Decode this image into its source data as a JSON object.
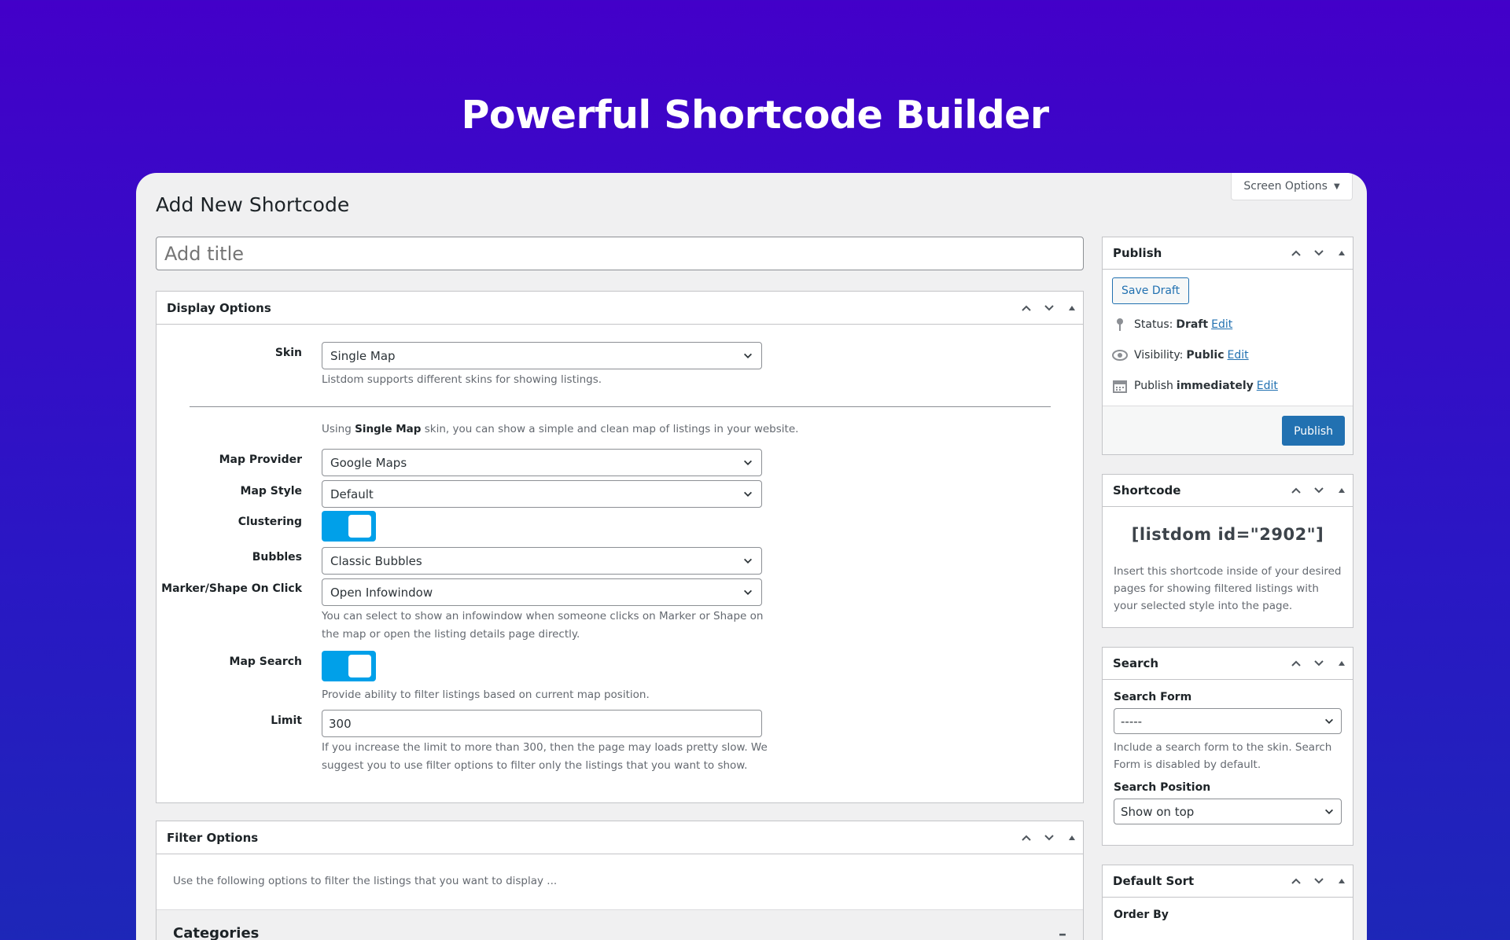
{
  "hero": {
    "title": "Powerful Shortcode Builder"
  },
  "screen_options": {
    "label": "Screen Options"
  },
  "page": {
    "title": "Add New Shortcode"
  },
  "title_input": {
    "placeholder": "Add title"
  },
  "display_options": {
    "title": "Display Options",
    "skin": {
      "label": "Skin",
      "value": "Single Map",
      "desc": "Listdom supports different skins for showing listings."
    },
    "skin_info": {
      "prefix": "Using ",
      "skin_name": "Single Map",
      "suffix": " skin, you can show a simple and clean map of listings in your website."
    },
    "map_provider": {
      "label": "Map Provider",
      "value": "Google Maps"
    },
    "map_style": {
      "label": "Map Style",
      "value": "Default"
    },
    "clustering": {
      "label": "Clustering",
      "enabled": true
    },
    "bubbles": {
      "label": "Bubbles",
      "value": "Classic Bubbles"
    },
    "marker_click": {
      "label": "Marker/Shape On Click",
      "value": "Open Infowindow",
      "desc": "You can select to show an infowindow when someone clicks on Marker or Shape on the map or open the listing details page directly."
    },
    "map_search": {
      "label": "Map Search",
      "enabled": true,
      "desc": "Provide ability to filter listings based on current map position."
    },
    "limit": {
      "label": "Limit",
      "value": "300",
      "desc": "If you increase the limit to more than 300, then the page may loads pretty slow. We suggest you to use filter options to filter only the listings that you want to show."
    }
  },
  "filter_options": {
    "title": "Filter Options",
    "desc": "Use the following options to filter the listings that you want to display ...",
    "categories_label": "Categories",
    "collapse_glyph": "–"
  },
  "publish": {
    "title": "Publish",
    "save_draft": "Save Draft",
    "status_label": "Status:",
    "status_value": "Draft",
    "visibility_label": "Visibility:",
    "visibility_value": "Public",
    "publish_label": "Publish",
    "publish_value": "immediately",
    "edit_link": "Edit",
    "publish_button": "Publish"
  },
  "shortcode": {
    "title": "Shortcode",
    "code": "[listdom id=\"2902\"]",
    "desc": "Insert this shortcode inside of your desired pages for showing filtered listings with your selected style into the page."
  },
  "search": {
    "title": "Search",
    "form_label": "Search Form",
    "form_value": "-----",
    "form_desc": "Include a search form to the skin. Search Form is disabled by default.",
    "position_label": "Search Position",
    "position_value": "Show on top"
  },
  "default_sort": {
    "title": "Default Sort",
    "order_by_label": "Order By"
  },
  "colors": {
    "accent": "#2271b1",
    "toggle": "#00a0e9",
    "background_top": "#4300c9",
    "background_bottom": "#1d27b8"
  },
  "icons": {
    "status": "pin-icon",
    "visibility": "eye-icon",
    "schedule": "calendar-icon",
    "move_up": "chevron-up-icon",
    "move_down": "chevron-down-icon",
    "toggle_panel": "triangle-up-icon"
  }
}
